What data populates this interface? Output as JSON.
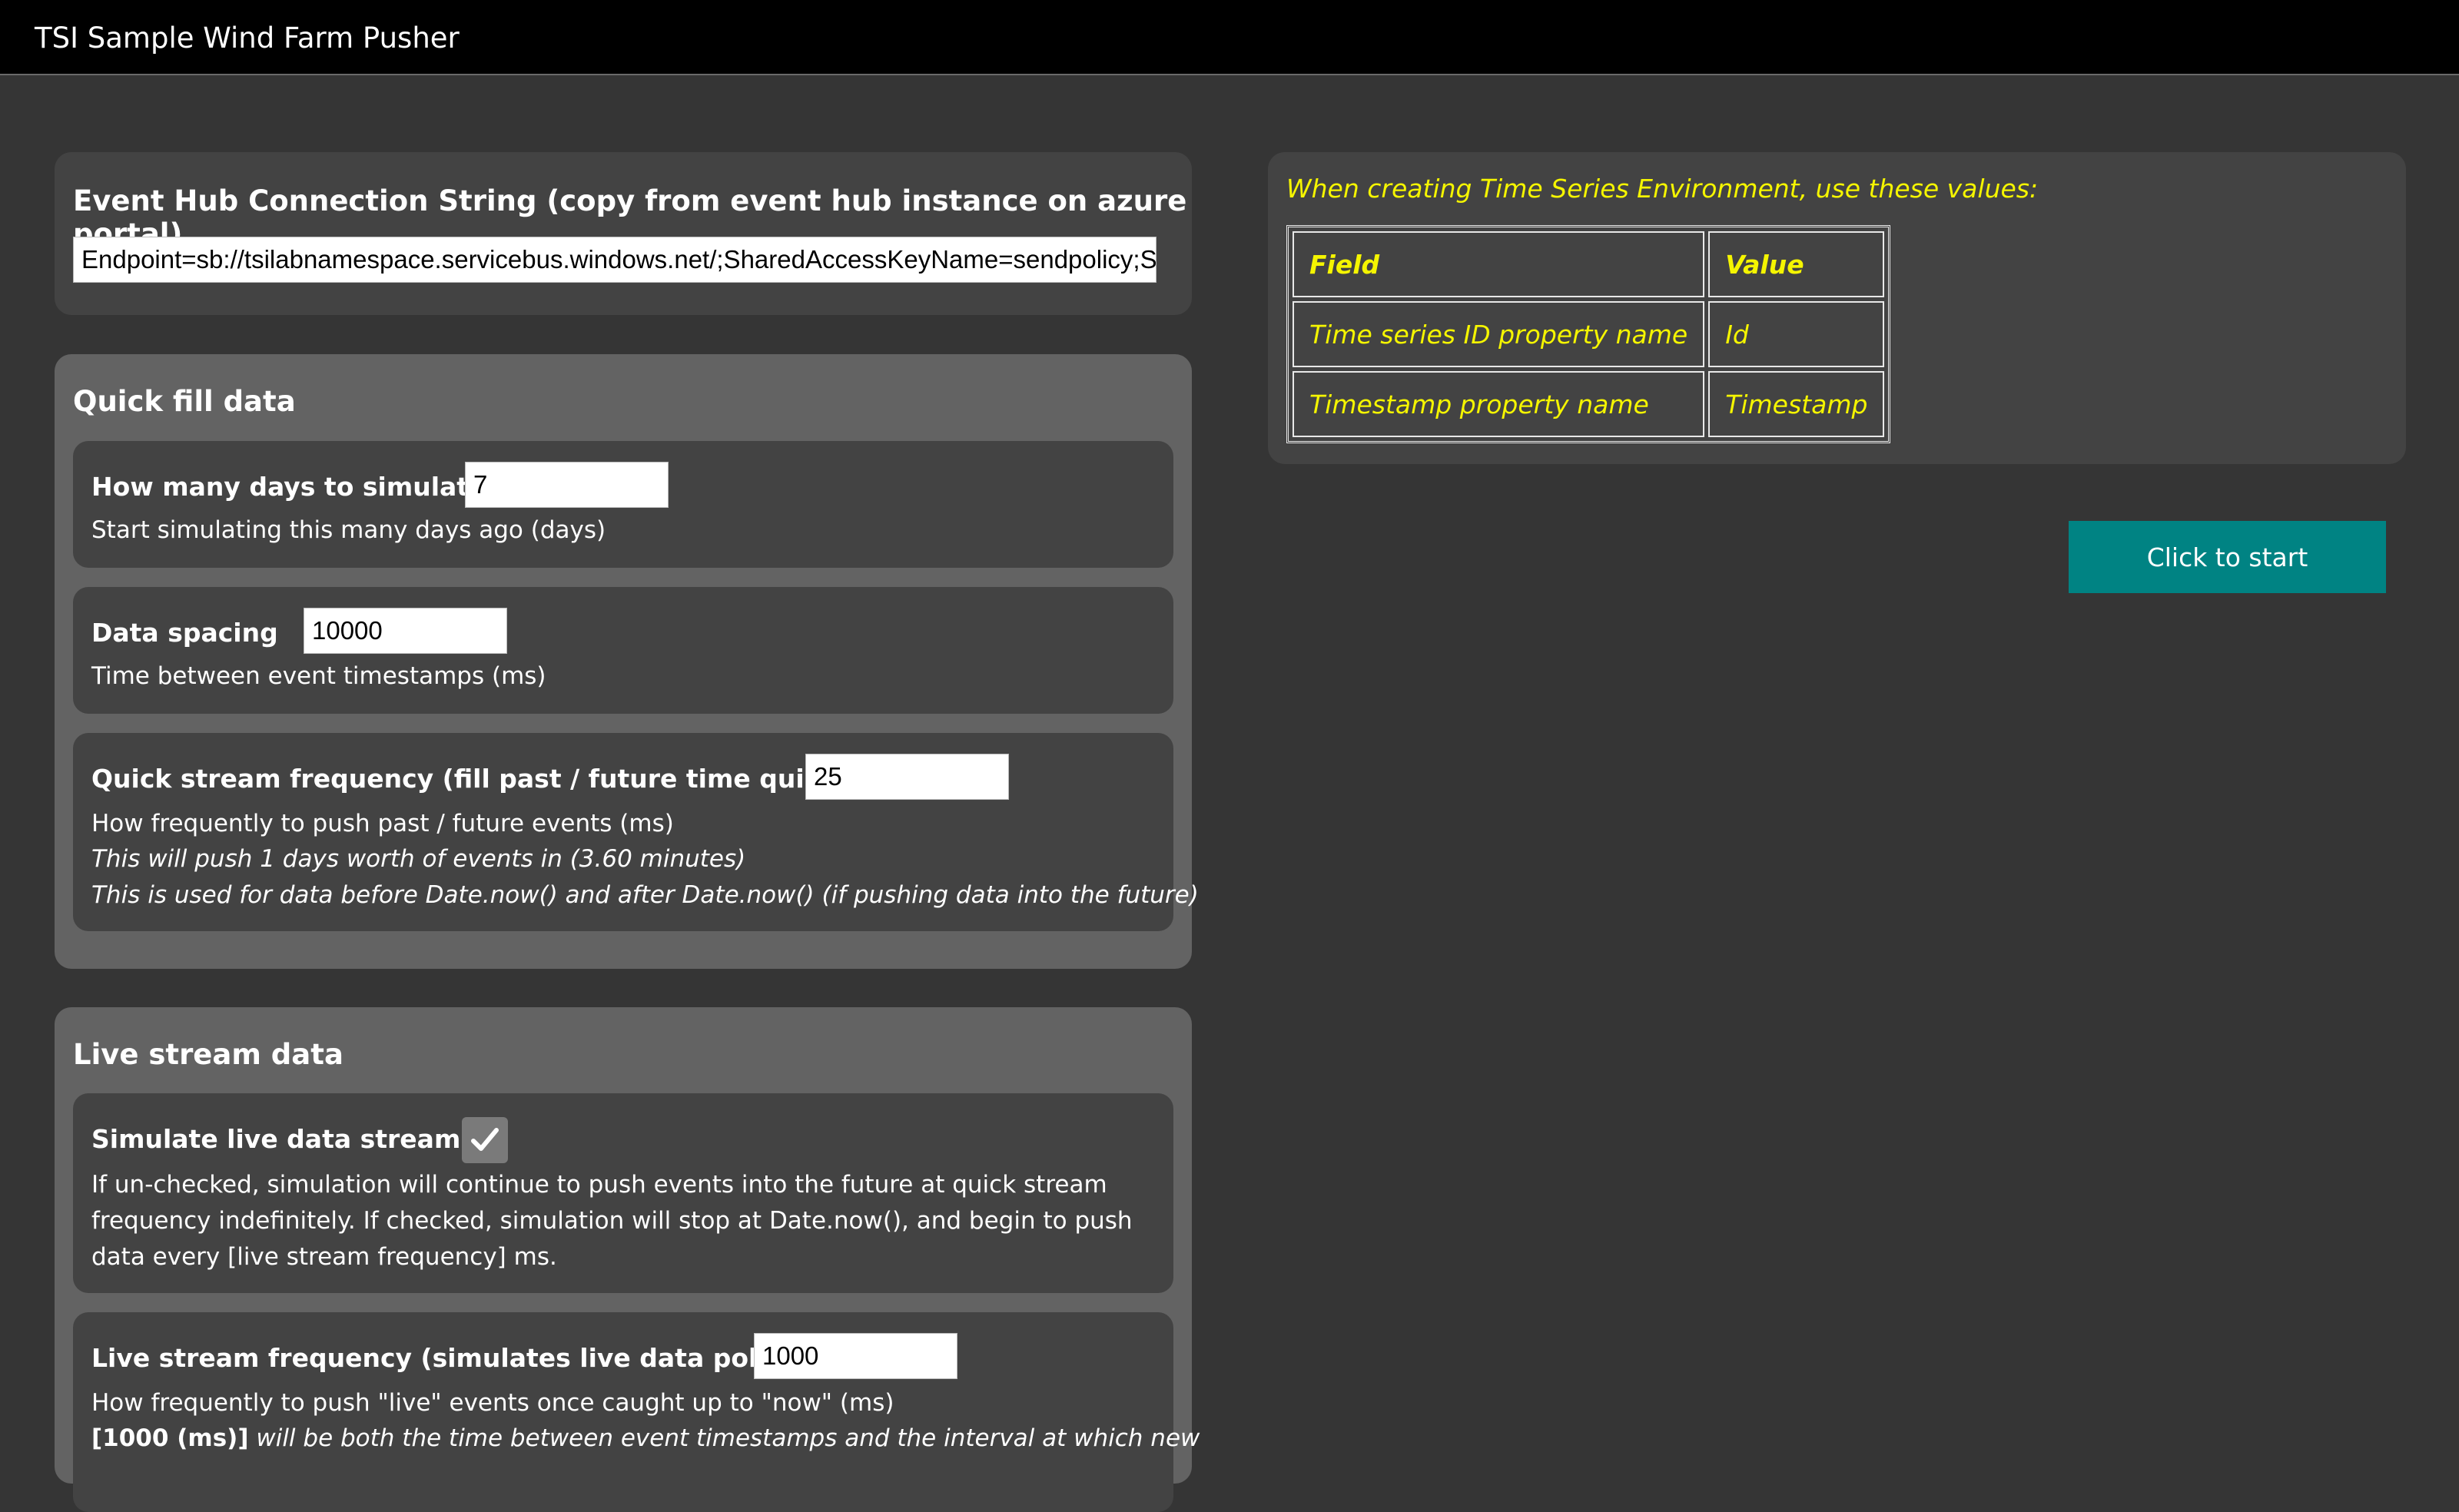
{
  "app": {
    "title": "TSI Sample Wind Farm Pusher"
  },
  "connection": {
    "heading": "Event Hub Connection String (copy from event hub instance on azure portal)",
    "value": "Endpoint=sb://tsilabnamespace.servicebus.windows.net/;SharedAccessKeyName=sendpolicy;S"
  },
  "quick_fill": {
    "heading": "Quick fill data",
    "days": {
      "label": "How many days to simulate",
      "value": "7",
      "description": "Start simulating this many days ago (days)"
    },
    "spacing": {
      "label": "Data spacing",
      "value": "10000",
      "description": "Time between event timestamps (ms)"
    },
    "frequency": {
      "label": "Quick stream frequency (fill past / future time quickly)",
      "value": "25",
      "description": "How frequently to push past / future events (ms)",
      "note1": "This will push 1 days worth of events in (3.60 minutes)",
      "note2": "This is used for data before Date.now() and after Date.now() (if pushing data into the future)"
    }
  },
  "live": {
    "heading": "Live stream data",
    "simulate": {
      "label": "Simulate live data stream?",
      "checked": true,
      "description": "If un-checked, simulation will continue to push events into the future at quick stream frequency indefinitely. If checked, simulation will stop at Date.now(), and begin to push data every [live stream frequency] ms."
    },
    "frequency": {
      "label": "Live stream frequency (simulates live data polling)",
      "value": "1000",
      "description": "How frequently to push \"live\" events once caught up to \"now\" (ms)",
      "note_bold": "[1000 (ms)]",
      "note_rest": " will be both the time between event timestamps and the interval at which new"
    }
  },
  "tsi_info": {
    "hint": "When creating Time Series Environment, use these values:",
    "headers": [
      "Field",
      "Value"
    ],
    "rows": [
      [
        "Time series ID property name",
        "Id"
      ],
      [
        "Timestamp property name",
        "Timestamp"
      ]
    ]
  },
  "start_button": {
    "label": "Click to start"
  },
  "colors": {
    "accent": "#008383",
    "highlight": "#f5f500"
  }
}
